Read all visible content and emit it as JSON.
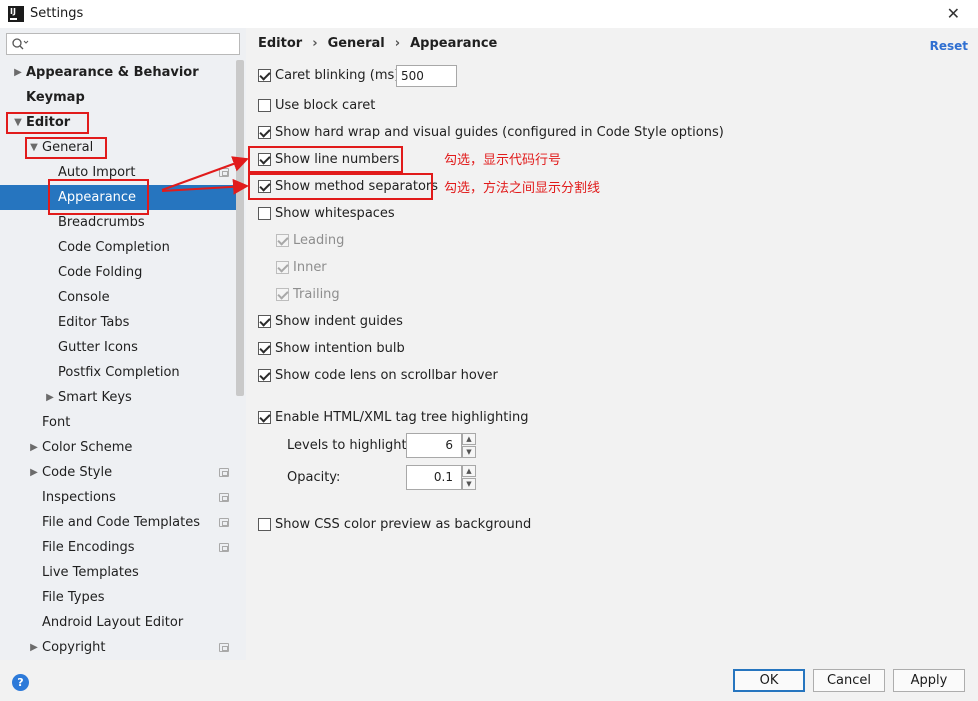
{
  "window": {
    "title": "Settings",
    "app_icon_text": "IJ"
  },
  "search": {
    "placeholder": "",
    "value": ""
  },
  "sidebar": {
    "items": [
      {
        "label": "Appearance & Behavior",
        "level": 0,
        "arrow": "right",
        "bold": true
      },
      {
        "label": "Keymap",
        "level": 0,
        "arrow": "",
        "bold": true
      },
      {
        "label": "Editor",
        "level": 0,
        "arrow": "down",
        "bold": true
      },
      {
        "label": "General",
        "level": 1,
        "arrow": "down",
        "bold": false
      },
      {
        "label": "Auto Import",
        "level": 2,
        "arrow": "",
        "bold": false,
        "badge": true
      },
      {
        "label": "Appearance",
        "level": 2,
        "arrow": "",
        "bold": false,
        "selected": true
      },
      {
        "label": "Breadcrumbs",
        "level": 2,
        "arrow": "",
        "bold": false
      },
      {
        "label": "Code Completion",
        "level": 2,
        "arrow": "",
        "bold": false
      },
      {
        "label": "Code Folding",
        "level": 2,
        "arrow": "",
        "bold": false
      },
      {
        "label": "Console",
        "level": 2,
        "arrow": "",
        "bold": false
      },
      {
        "label": "Editor Tabs",
        "level": 2,
        "arrow": "",
        "bold": false
      },
      {
        "label": "Gutter Icons",
        "level": 2,
        "arrow": "",
        "bold": false
      },
      {
        "label": "Postfix Completion",
        "level": 2,
        "arrow": "",
        "bold": false
      },
      {
        "label": "Smart Keys",
        "level": 2,
        "arrow": "right",
        "bold": false
      },
      {
        "label": "Font",
        "level": 1,
        "arrow": "",
        "bold": false
      },
      {
        "label": "Color Scheme",
        "level": 1,
        "arrow": "right",
        "bold": false
      },
      {
        "label": "Code Style",
        "level": 1,
        "arrow": "right",
        "bold": false,
        "badge": true
      },
      {
        "label": "Inspections",
        "level": 1,
        "arrow": "",
        "bold": false,
        "badge": true
      },
      {
        "label": "File and Code Templates",
        "level": 1,
        "arrow": "",
        "bold": false,
        "badge": true
      },
      {
        "label": "File Encodings",
        "level": 1,
        "arrow": "",
        "bold": false,
        "badge": true
      },
      {
        "label": "Live Templates",
        "level": 1,
        "arrow": "",
        "bold": false
      },
      {
        "label": "File Types",
        "level": 1,
        "arrow": "",
        "bold": false
      },
      {
        "label": "Android Layout Editor",
        "level": 1,
        "arrow": "",
        "bold": false
      },
      {
        "label": "Copyright",
        "level": 1,
        "arrow": "right",
        "bold": false,
        "badge": true
      }
    ]
  },
  "breadcrumb": [
    "Editor",
    "General",
    "Appearance"
  ],
  "breadcrumb_sep": "›",
  "reset_label": "Reset",
  "options": {
    "caret_blinking": {
      "label": "Caret blinking (ms):",
      "checked": true,
      "value": "500"
    },
    "block_caret": {
      "label": "Use block caret",
      "checked": false
    },
    "hard_wrap": {
      "label": "Show hard wrap and visual guides (configured in Code Style options)",
      "checked": true
    },
    "line_numbers": {
      "label": "Show line numbers",
      "checked": true
    },
    "method_separators": {
      "label": "Show method separators",
      "checked": true
    },
    "whitespaces": {
      "label": "Show whitespaces",
      "checked": false
    },
    "leading": {
      "label": "Leading",
      "checked": true,
      "disabled": true
    },
    "inner": {
      "label": "Inner",
      "checked": true,
      "disabled": true
    },
    "trailing": {
      "label": "Trailing",
      "checked": true,
      "disabled": true
    },
    "indent_guides": {
      "label": "Show indent guides",
      "checked": true
    },
    "intention_bulb": {
      "label": "Show intention bulb",
      "checked": true
    },
    "code_lens": {
      "label": "Show code lens on scrollbar hover",
      "checked": true
    },
    "tag_tree": {
      "label": "Enable HTML/XML tag tree highlighting",
      "checked": true
    },
    "levels": {
      "label": "Levels to highlight:",
      "value": "6"
    },
    "opacity": {
      "label": "Opacity:",
      "value": "0.1"
    },
    "css_color": {
      "label": "Show CSS color preview as background",
      "checked": false
    }
  },
  "annotations": {
    "line_numbers_note": "勾选，显示代码行号",
    "method_separators_note": "勾选，方法之间显示分割线",
    "color": "#e11b1b"
  },
  "footer": {
    "ok": "OK",
    "cancel": "Cancel",
    "apply": "Apply",
    "help": "?"
  },
  "colors": {
    "selection": "#2675bf",
    "link": "#2f6fd1",
    "sidebar_bg": "#eef0f3",
    "panel_bg": "#f2f2f2"
  }
}
